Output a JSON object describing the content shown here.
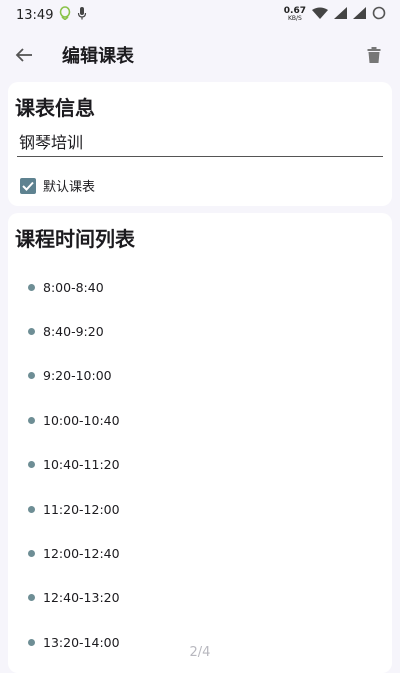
{
  "status": {
    "time": "13:49",
    "net_speed_value": "0.67",
    "net_speed_unit": "KB/S"
  },
  "app_bar": {
    "title": "编辑课表"
  },
  "info_card": {
    "heading": "课表信息",
    "schedule_name": "钢琴培训",
    "default_label": "默认课表",
    "default_checked": true
  },
  "list_card": {
    "heading": "课程时间列表",
    "slots": [
      "8:00-8:40",
      "8:40-9:20",
      "9:20-10:00",
      "10:00-10:40",
      "10:40-11:20",
      "11:20-12:00",
      "12:00-12:40",
      "12:40-13:20",
      "13:20-14:00"
    ]
  },
  "page_indicator": "2/4",
  "colors": {
    "accent": "#5e8290",
    "dot": "#6e8e95",
    "background": "#f6f5fb"
  }
}
